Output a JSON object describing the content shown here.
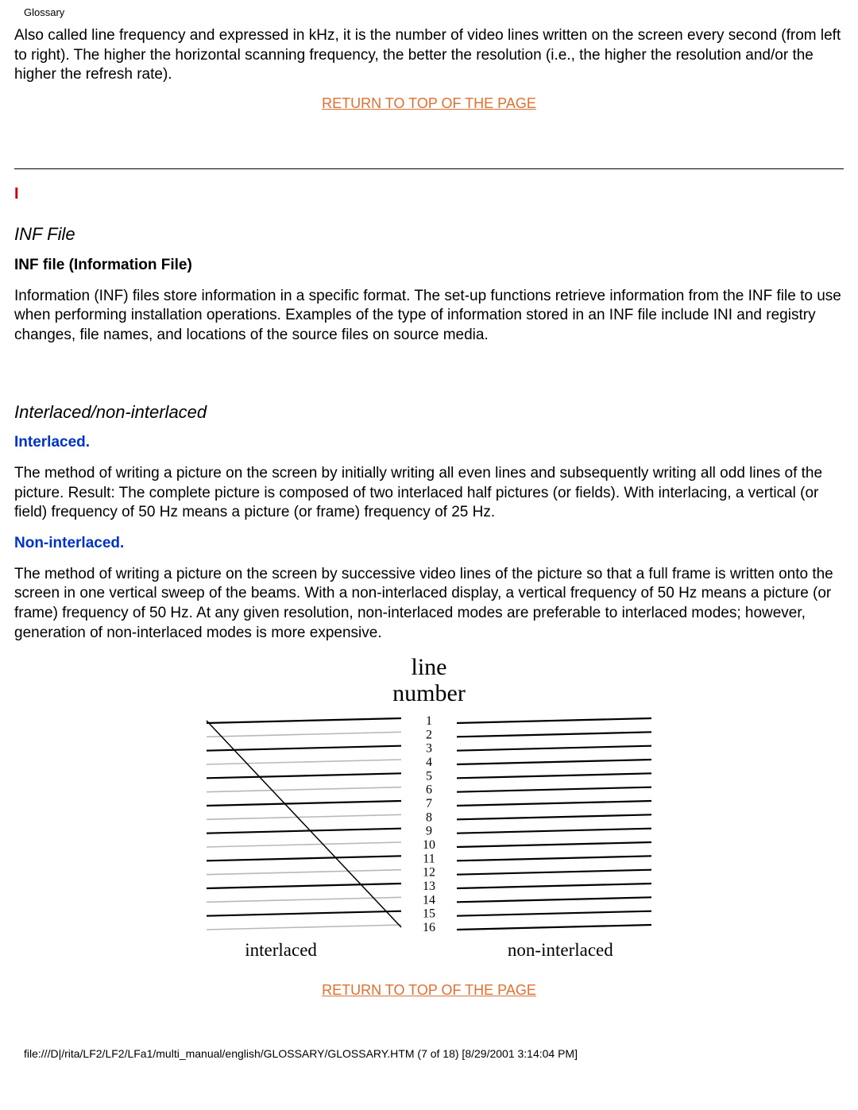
{
  "header_label": "Glossary",
  "intro": "Also called line frequency and expressed in kHz, it is the number of video lines written on the screen every second (from left to right). The higher the horizontal scanning frequency, the better the resolution (i.e., the higher the resolution and/or the higher the refresh rate).",
  "return_link": "RETURN TO TOP OF THE PAGE",
  "section_letter": "I",
  "inf": {
    "title": "INF File",
    "subtitle": "INF file (Information File)",
    "body": "Information (INF) files store information in a specific format. The set-up functions retrieve information from the INF file to use when performing installation operations. Examples of the type of information stored in an INF file include INI and registry changes, file names, and locations of the source files on source media."
  },
  "interlaced": {
    "title": "Interlaced/non-interlaced",
    "sub1": "Interlaced.",
    "body1": "The method of writing a picture on the screen by initially writing all even lines and subsequently writing all odd lines of the picture. Result: The complete picture is composed of two interlaced half pictures (or fields). With interlacing, a vertical (or field) frequency of 50 Hz means a picture (or frame) frequency of 25 Hz.",
    "sub2": "Non-interlaced.",
    "body2": "The method of writing a picture on the screen by successive video lines of the picture so that a full frame is written onto the screen in one vertical sweep of the beams. With a non-interlaced display, a vertical frequency of 50 Hz means a picture (or frame) frequency of 50 Hz. At any given resolution, non-interlaced modes are preferable to interlaced modes; however, generation of non-interlaced modes is more expensive."
  },
  "diagram": {
    "title_line1": "line",
    "title_line2": "number",
    "label_left": "interlaced",
    "label_right": "non-interlaced",
    "line_numbers": [
      "1",
      "2",
      "3",
      "4",
      "5",
      "6",
      "7",
      "8",
      "9",
      "10",
      "11",
      "12",
      "13",
      "14",
      "15",
      "16"
    ]
  },
  "footer": "file:///D|/rita/LF2/LF2/LFa1/multi_manual/english/GLOSSARY/GLOSSARY.HTM (7 of 18) [8/29/2001 3:14:04 PM]"
}
